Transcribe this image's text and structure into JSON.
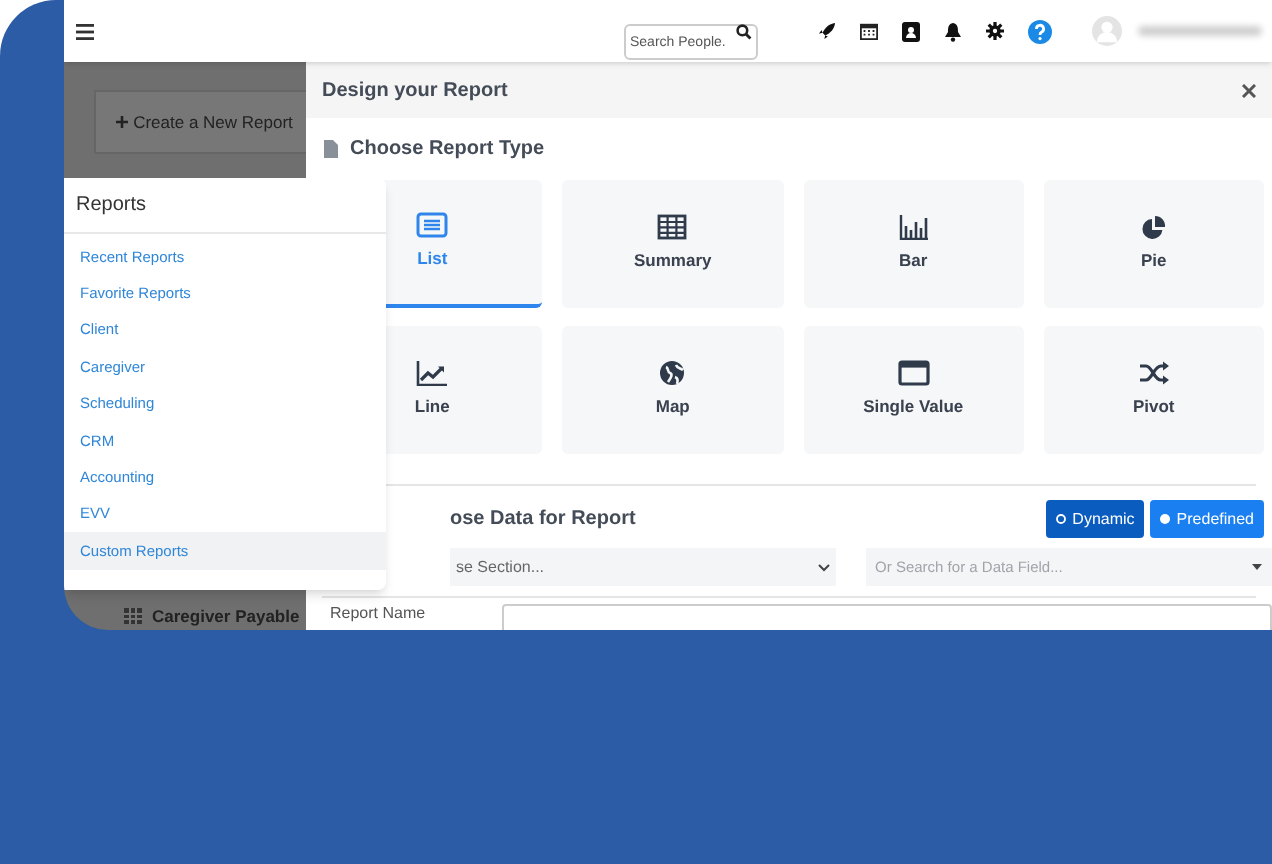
{
  "header": {
    "search": {
      "placeholder": "Search People."
    }
  },
  "background_page": {
    "create_button": "Create a New Report",
    "list_item": "Caregiver Payable"
  },
  "modal": {
    "title": "Design your Report",
    "report_type_heading": "Choose Report Type",
    "report_types": [
      {
        "label": "List",
        "kind": "list",
        "selected": true
      },
      {
        "label": "Summary",
        "kind": "table",
        "selected": false
      },
      {
        "label": "Bar",
        "kind": "bar",
        "selected": false
      },
      {
        "label": "Pie",
        "kind": "pie",
        "selected": false
      },
      {
        "label": "Line",
        "kind": "line",
        "selected": false
      },
      {
        "label": "Map",
        "kind": "globe",
        "selected": false
      },
      {
        "label": "Single Value",
        "kind": "window",
        "selected": false
      },
      {
        "label": "Pivot",
        "kind": "shuffle",
        "selected": false
      }
    ],
    "data_heading": "ose Data for Report",
    "modes": [
      {
        "label": "Dynamic",
        "selected": false
      },
      {
        "label": "Predefined",
        "selected": true
      }
    ],
    "section_select": {
      "placeholder": "se Section..."
    },
    "field_search": {
      "placeholder": "Or Search for a Data Field..."
    },
    "report_name": {
      "label": "Report Name"
    }
  },
  "reports_menu": {
    "title": "Reports",
    "items": [
      {
        "label": "Recent Reports",
        "selected": false
      },
      {
        "label": "Favorite Reports",
        "selected": false
      },
      {
        "label": "Client",
        "selected": false
      },
      {
        "label": "Caregiver",
        "selected": false
      },
      {
        "label": "Scheduling",
        "selected": false
      },
      {
        "label": "CRM",
        "selected": false
      },
      {
        "label": "Accounting",
        "selected": false
      },
      {
        "label": "EVV",
        "selected": false
      },
      {
        "label": "Custom Reports",
        "selected": true
      }
    ]
  }
}
